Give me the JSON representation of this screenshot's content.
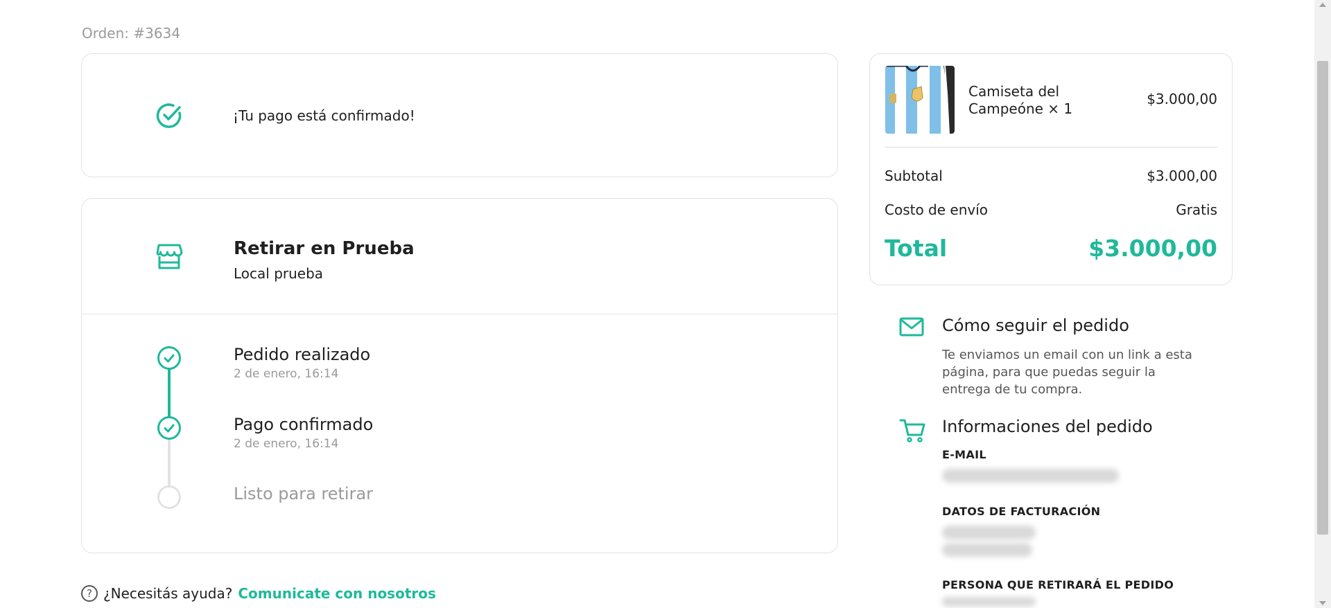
{
  "order": {
    "label": "Orden: #3634"
  },
  "confirmation": {
    "text": "¡Tu pago está confirmado!"
  },
  "pickup": {
    "title": "Retirar en Prueba",
    "subtitle": "Local prueba",
    "steps": [
      {
        "title": "Pedido realizado",
        "date": "2 de enero, 16:14",
        "status": "done"
      },
      {
        "title": "Pago confirmado",
        "date": "2 de enero, 16:14",
        "status": "done"
      },
      {
        "title": "Listo para retirar",
        "date": "",
        "status": "pending"
      }
    ]
  },
  "help": {
    "question": "¿Necesitás ayuda?",
    "link": "Comunicate con nosotros"
  },
  "summary": {
    "product": {
      "name": "Camiseta del Campeóne × 1",
      "price": "$3.000,00",
      "image_icon": "jersey-thumbnail"
    },
    "subtotal_label": "Subtotal",
    "subtotal_value": "$3.000,00",
    "shipping_label": "Costo de envío",
    "shipping_value": "Gratis",
    "total_label": "Total",
    "total_value": "$3.000,00"
  },
  "tracking": {
    "title": "Cómo seguir el pedido",
    "body": "Te enviamos un email con un link a esta página, para que puedas seguir la entrega de tu compra."
  },
  "order_info": {
    "title": "Informaciones del pedido",
    "email_label": "E-MAIL",
    "billing_label": "DATOS DE FACTURACIÓN",
    "pickup_person_label": "PERSONA QUE RETIRARÁ EL PEDIDO"
  },
  "colors": {
    "accent": "#1fb99a",
    "border": "#e2e2e2",
    "muted": "#9a9a9a"
  }
}
